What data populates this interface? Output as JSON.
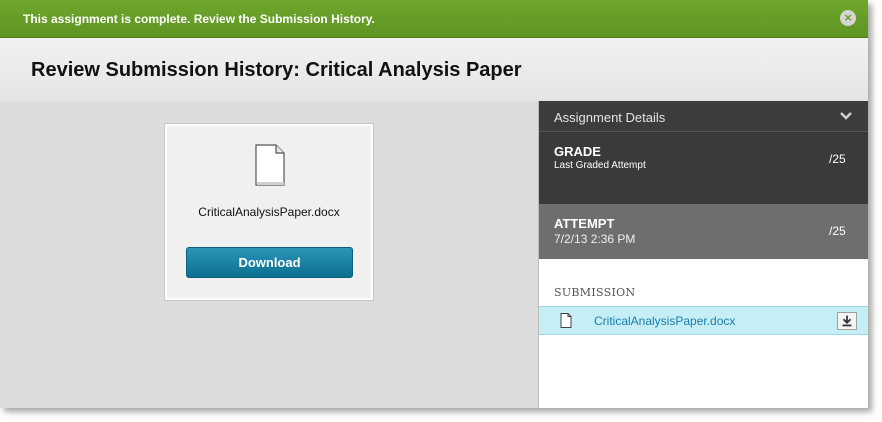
{
  "banner": {
    "message": "This assignment is complete. Review the Submission History.",
    "close_glyph": "×"
  },
  "page": {
    "title": "Review Submission History: Critical Analysis Paper"
  },
  "file_card": {
    "file_name": "CriticalAnalysisPaper.docx",
    "download_label": "Download"
  },
  "details": {
    "header_title": "Assignment Details",
    "grade": {
      "title": "GRADE",
      "subtitle": "Last Graded Attempt",
      "score": "/25"
    },
    "attempt": {
      "title": "ATTEMPT",
      "timestamp": "7/2/13 2:36 PM",
      "score": "/25"
    },
    "submission": {
      "label": "SUBMISSION",
      "file_name": "CriticalAnalysisPaper.docx"
    }
  },
  "colors": {
    "banner_green": "#659a26",
    "button_teal": "#1a82a5",
    "panel_dark": "#3a3a3a",
    "panel_mid": "#6e6e6e",
    "row_highlight": "#c5eef7"
  }
}
